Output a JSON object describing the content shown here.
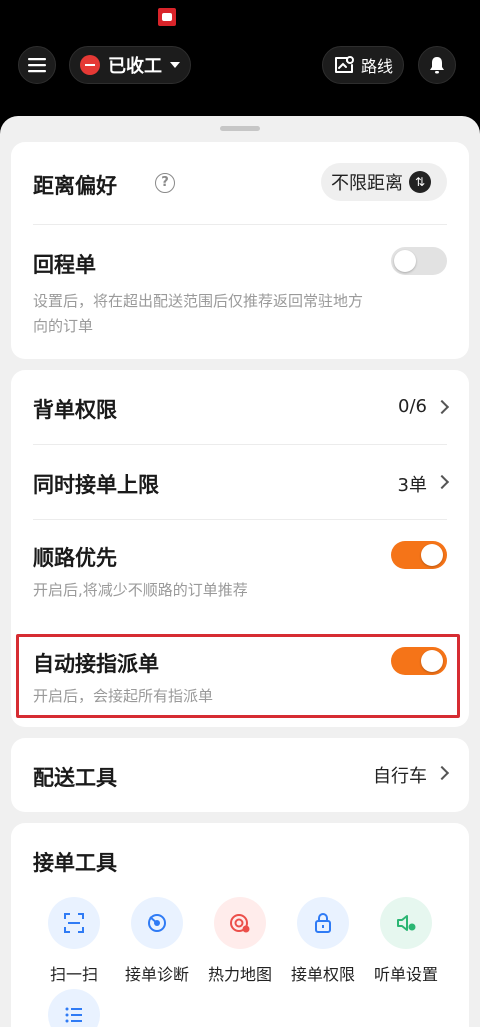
{
  "header": {
    "status_label": "已收工",
    "route_label": "路线"
  },
  "settings": {
    "distance_pref": {
      "title": "距离偏好",
      "help": "?",
      "value": "不限距离"
    },
    "return_order": {
      "title": "回程单",
      "desc_line1": "设置后，将在超出配送范围后仅推荐返回常驻地方",
      "desc_line2": "向的订单",
      "enabled": false
    },
    "carry_permission": {
      "title": "背单权限",
      "value": "0/6"
    },
    "max_concurrent": {
      "title": "同时接单上限",
      "value": "3单"
    },
    "route_priority": {
      "title": "顺路优先",
      "desc": "开启后,将减少不顺路的订单推荐",
      "enabled": true
    },
    "auto_accept_dispatch": {
      "title": "自动接指派单",
      "desc": "开启后，会接起所有指派单",
      "enabled": true
    },
    "delivery_tool": {
      "title": "配送工具",
      "value": "自行车"
    }
  },
  "tools": {
    "title": "接单工具",
    "items": [
      {
        "label": "扫一扫",
        "icon": "scan-icon",
        "bg": "#e9f2ff",
        "color": "#2f7bf5"
      },
      {
        "label": "接单诊断",
        "icon": "diagnosis-icon",
        "bg": "#e9f2ff",
        "color": "#2f7bf5"
      },
      {
        "label": "热力地图",
        "icon": "heatmap-icon",
        "bg": "#ffeceb",
        "color": "#ec4f4a"
      },
      {
        "label": "接单权限",
        "icon": "lock-icon",
        "bg": "#e9f2ff",
        "color": "#2f7bf5"
      },
      {
        "label": "听单设置",
        "icon": "listen-settings-icon",
        "bg": "#e6f7ef",
        "color": "#2bb673"
      }
    ],
    "more_icon": "list-icon"
  },
  "colors": {
    "accent_orange": "#f57418",
    "status_red": "#e53935",
    "highlight_red": "#d62c32"
  }
}
